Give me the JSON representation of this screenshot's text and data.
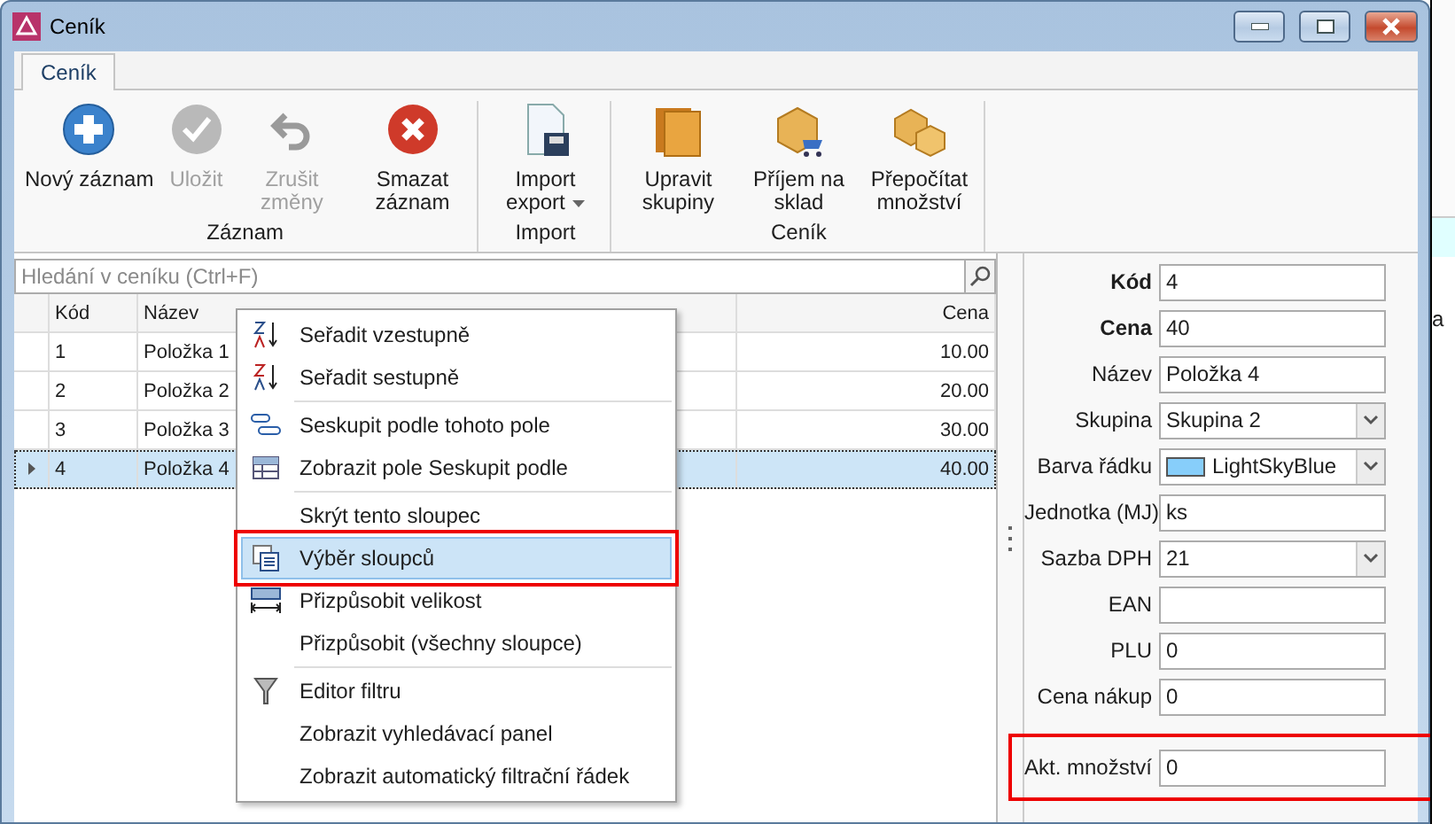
{
  "window": {
    "title": "Ceník"
  },
  "tabs": [
    {
      "label": "Ceník",
      "selected": true
    }
  ],
  "ribbon": [
    {
      "caption": "Záznam",
      "buttons": [
        {
          "label": "Nový záznam",
          "disabled": false,
          "dropdown": false
        },
        {
          "label": "Uložit",
          "disabled": true,
          "dropdown": false
        },
        {
          "label": "Zrušit změny",
          "disabled": true,
          "dropdown": false
        },
        {
          "label": "Smazat záznam",
          "disabled": false,
          "dropdown": false
        }
      ]
    },
    {
      "caption": "Import",
      "buttons": [
        {
          "label": "Import export",
          "disabled": false,
          "dropdown": true
        }
      ]
    },
    {
      "caption": "Ceník",
      "buttons": [
        {
          "label": "Upravit skupiny",
          "disabled": false,
          "dropdown": false
        },
        {
          "label": "Příjem na sklad",
          "disabled": false,
          "dropdown": false
        },
        {
          "label": "Přepočítat množství",
          "disabled": false,
          "dropdown": false
        }
      ]
    }
  ],
  "search": {
    "placeholder": "Hledání v ceníku (Ctrl+F)"
  },
  "grid": {
    "columns": [
      "Kód",
      "Název",
      "Cena"
    ],
    "rows": [
      {
        "code": "1",
        "name": "Položka 1",
        "price": "10.00",
        "selected": false
      },
      {
        "code": "2",
        "name": "Položka 2",
        "price": "20.00",
        "selected": false
      },
      {
        "code": "3",
        "name": "Položka 3",
        "price": "30.00",
        "selected": false
      },
      {
        "code": "4",
        "name": "Položka 4",
        "price": "40.00",
        "selected": true
      }
    ]
  },
  "context_menu": {
    "groups": [
      [
        {
          "label": "Seřadit vzestupně",
          "selected": false,
          "annotated": false
        },
        {
          "label": "Seřadit sestupně",
          "selected": false,
          "annotated": false
        }
      ],
      [
        {
          "label": "Seskupit podle tohoto pole",
          "selected": false,
          "annotated": false
        },
        {
          "label": "Zobrazit pole Seskupit podle",
          "selected": false,
          "annotated": false
        }
      ],
      [
        {
          "label": "Skrýt tento sloupec",
          "selected": false,
          "annotated": false
        },
        {
          "label": "Výběr sloupců",
          "selected": true,
          "annotated": true
        },
        {
          "label": "Přizpůsobit velikost",
          "selected": false,
          "annotated": false
        },
        {
          "label": "Přizpůsobit (všechny sloupce)",
          "selected": false,
          "annotated": false
        }
      ],
      [
        {
          "label": "Editor filtru",
          "selected": false,
          "annotated": false
        },
        {
          "label": "Zobrazit vyhledávací panel",
          "selected": false,
          "annotated": false
        },
        {
          "label": "Zobrazit automatický filtrační řádek",
          "selected": false,
          "annotated": false
        }
      ]
    ]
  },
  "form": {
    "fields": [
      {
        "label": "Kód",
        "value": "4",
        "kind": "text",
        "bold": true
      },
      {
        "label": "Cena",
        "value": "40",
        "kind": "text",
        "bold": true
      },
      {
        "label": "Název",
        "value": "Položka 4",
        "kind": "text",
        "bold": false
      },
      {
        "label": "Skupina",
        "value": "Skupina 2",
        "kind": "combo",
        "bold": false
      },
      {
        "label": "Barva řádku",
        "value": "LightSkyBlue",
        "kind": "color",
        "bold": false,
        "color": "#87cefa"
      },
      {
        "label": "Jednotka (MJ)",
        "value": "ks",
        "kind": "text",
        "bold": false
      },
      {
        "label": "Sazba DPH",
        "value": "21",
        "kind": "combo",
        "bold": false
      },
      {
        "label": "EAN",
        "kind": "text",
        "bold": false
      },
      {
        "label": "PLU",
        "value": "0",
        "kind": "text",
        "bold": false
      },
      {
        "label": "Cena nákup",
        "value": "0",
        "kind": "text",
        "bold": false
      }
    ],
    "quantity": {
      "label": "Akt. množství",
      "value": "0",
      "annotated": true
    }
  },
  "background_window": {
    "text": "a"
  }
}
